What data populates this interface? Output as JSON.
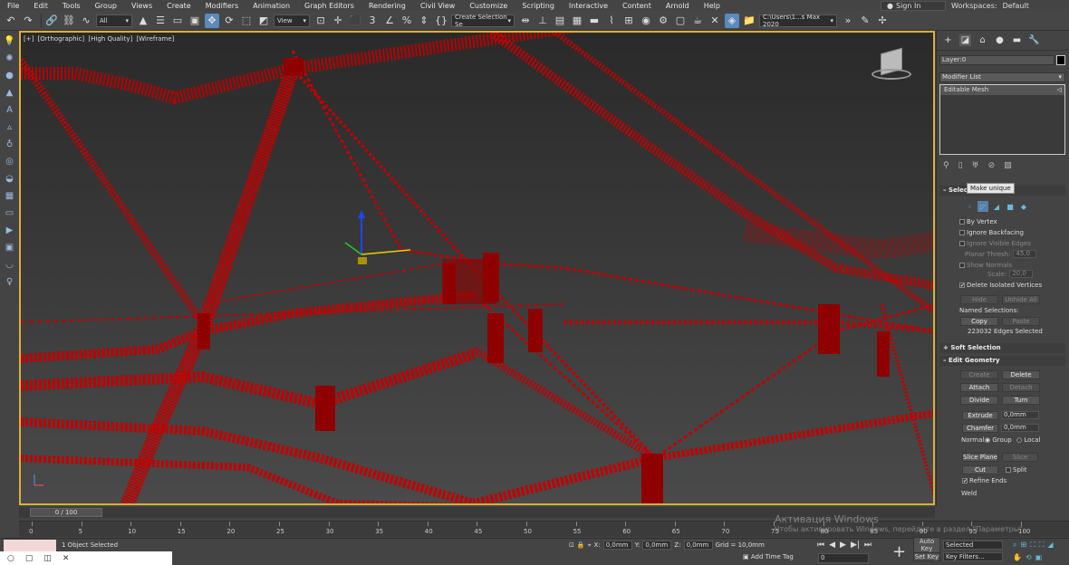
{
  "menu": [
    "File",
    "Edit",
    "Tools",
    "Group",
    "Views",
    "Create",
    "Modifiers",
    "Animation",
    "Graph Editors",
    "Rendering",
    "Civil View",
    "Customize",
    "Scripting",
    "Interactive",
    "Content",
    "Arnold",
    "Help"
  ],
  "signin": "Sign In",
  "workspaces_label": "Workspaces:",
  "workspaces_value": "Default",
  "toolbar": {
    "filter_select": "All",
    "view_select": "View",
    "create_selection": "Create Selection Se",
    "path": "C:\\Users\\1...s Max 2020"
  },
  "viewport": {
    "label_plus": "[+]",
    "label_ortho": "[Orthographic]",
    "label_quality": "[High Quality]",
    "label_shading": "[Wireframe]"
  },
  "panel": {
    "layer": "Layer:0",
    "modifier_list": "Modifier List",
    "stack_item": "Editable Mesh",
    "tooltip": "Make unique",
    "selection_head": "Selection",
    "by_vertex": "By Vertex",
    "ignore_backfacing": "Ignore Backfacing",
    "ignore_visible_edges": "Ignore Visible Edges",
    "planar_thresh": "Planar Thresh:",
    "planar_value": "45,0",
    "show_normals": "Show Normals",
    "scale_label": "Scale:",
    "scale_value": "20,0",
    "delete_isolated": "Delete Isolated Vertices",
    "hide": "Hide",
    "unhide_all": "Unhide All",
    "named_selections": "Named Selections:",
    "copy": "Copy",
    "paste": "Paste",
    "selected_count": "223032 Edges Selected",
    "soft_selection": "Soft Selection",
    "edit_geometry": "Edit Geometry",
    "create": "Create",
    "delete": "Delete",
    "attach": "Attach",
    "detach": "Detach",
    "divide": "Divide",
    "turn": "Turn",
    "extrude": "Extrude",
    "extrude_value": "0,0mm",
    "chamfer": "Chamfer",
    "chamfer_value": "0,0mm",
    "normal_label": "Normal:",
    "group": "Group",
    "local": "Local",
    "slice_plane": "Slice Plane",
    "slice": "Slice",
    "cut": "Cut",
    "split": "Split",
    "refine_ends": "Refine Ends",
    "weld": "Weld"
  },
  "timeline": {
    "slider": "0 / 100",
    "ticks": [
      "0",
      "5",
      "10",
      "15",
      "20",
      "25",
      "30",
      "35",
      "40",
      "45",
      "50",
      "55",
      "60",
      "65",
      "70",
      "75",
      "80",
      "85",
      "90",
      "95",
      "100"
    ]
  },
  "status": {
    "objects": "1 Object Selected",
    "x_label": "X:",
    "x_value": "0,0mm",
    "y_label": "Y:",
    "y_value": "0,0mm",
    "z_label": "Z:",
    "z_value": "0,0mm",
    "grid": "Grid = 10,0mm",
    "add_time_tag": "Add Time Tag",
    "frame": "0",
    "auto_key": "Auto Key",
    "selected": "Selected",
    "set_key": "Set Key",
    "key_filters": "Key Filters..."
  },
  "watermark": {
    "title": "Активация Windows",
    "subtitle": "Чтобы активировать Windows, перейдите в раздел \"Параметры\"."
  },
  "colors": {
    "viewport_border": "#d9b13c",
    "wireframe": "#c00000",
    "accent": "#5a8bbd"
  }
}
